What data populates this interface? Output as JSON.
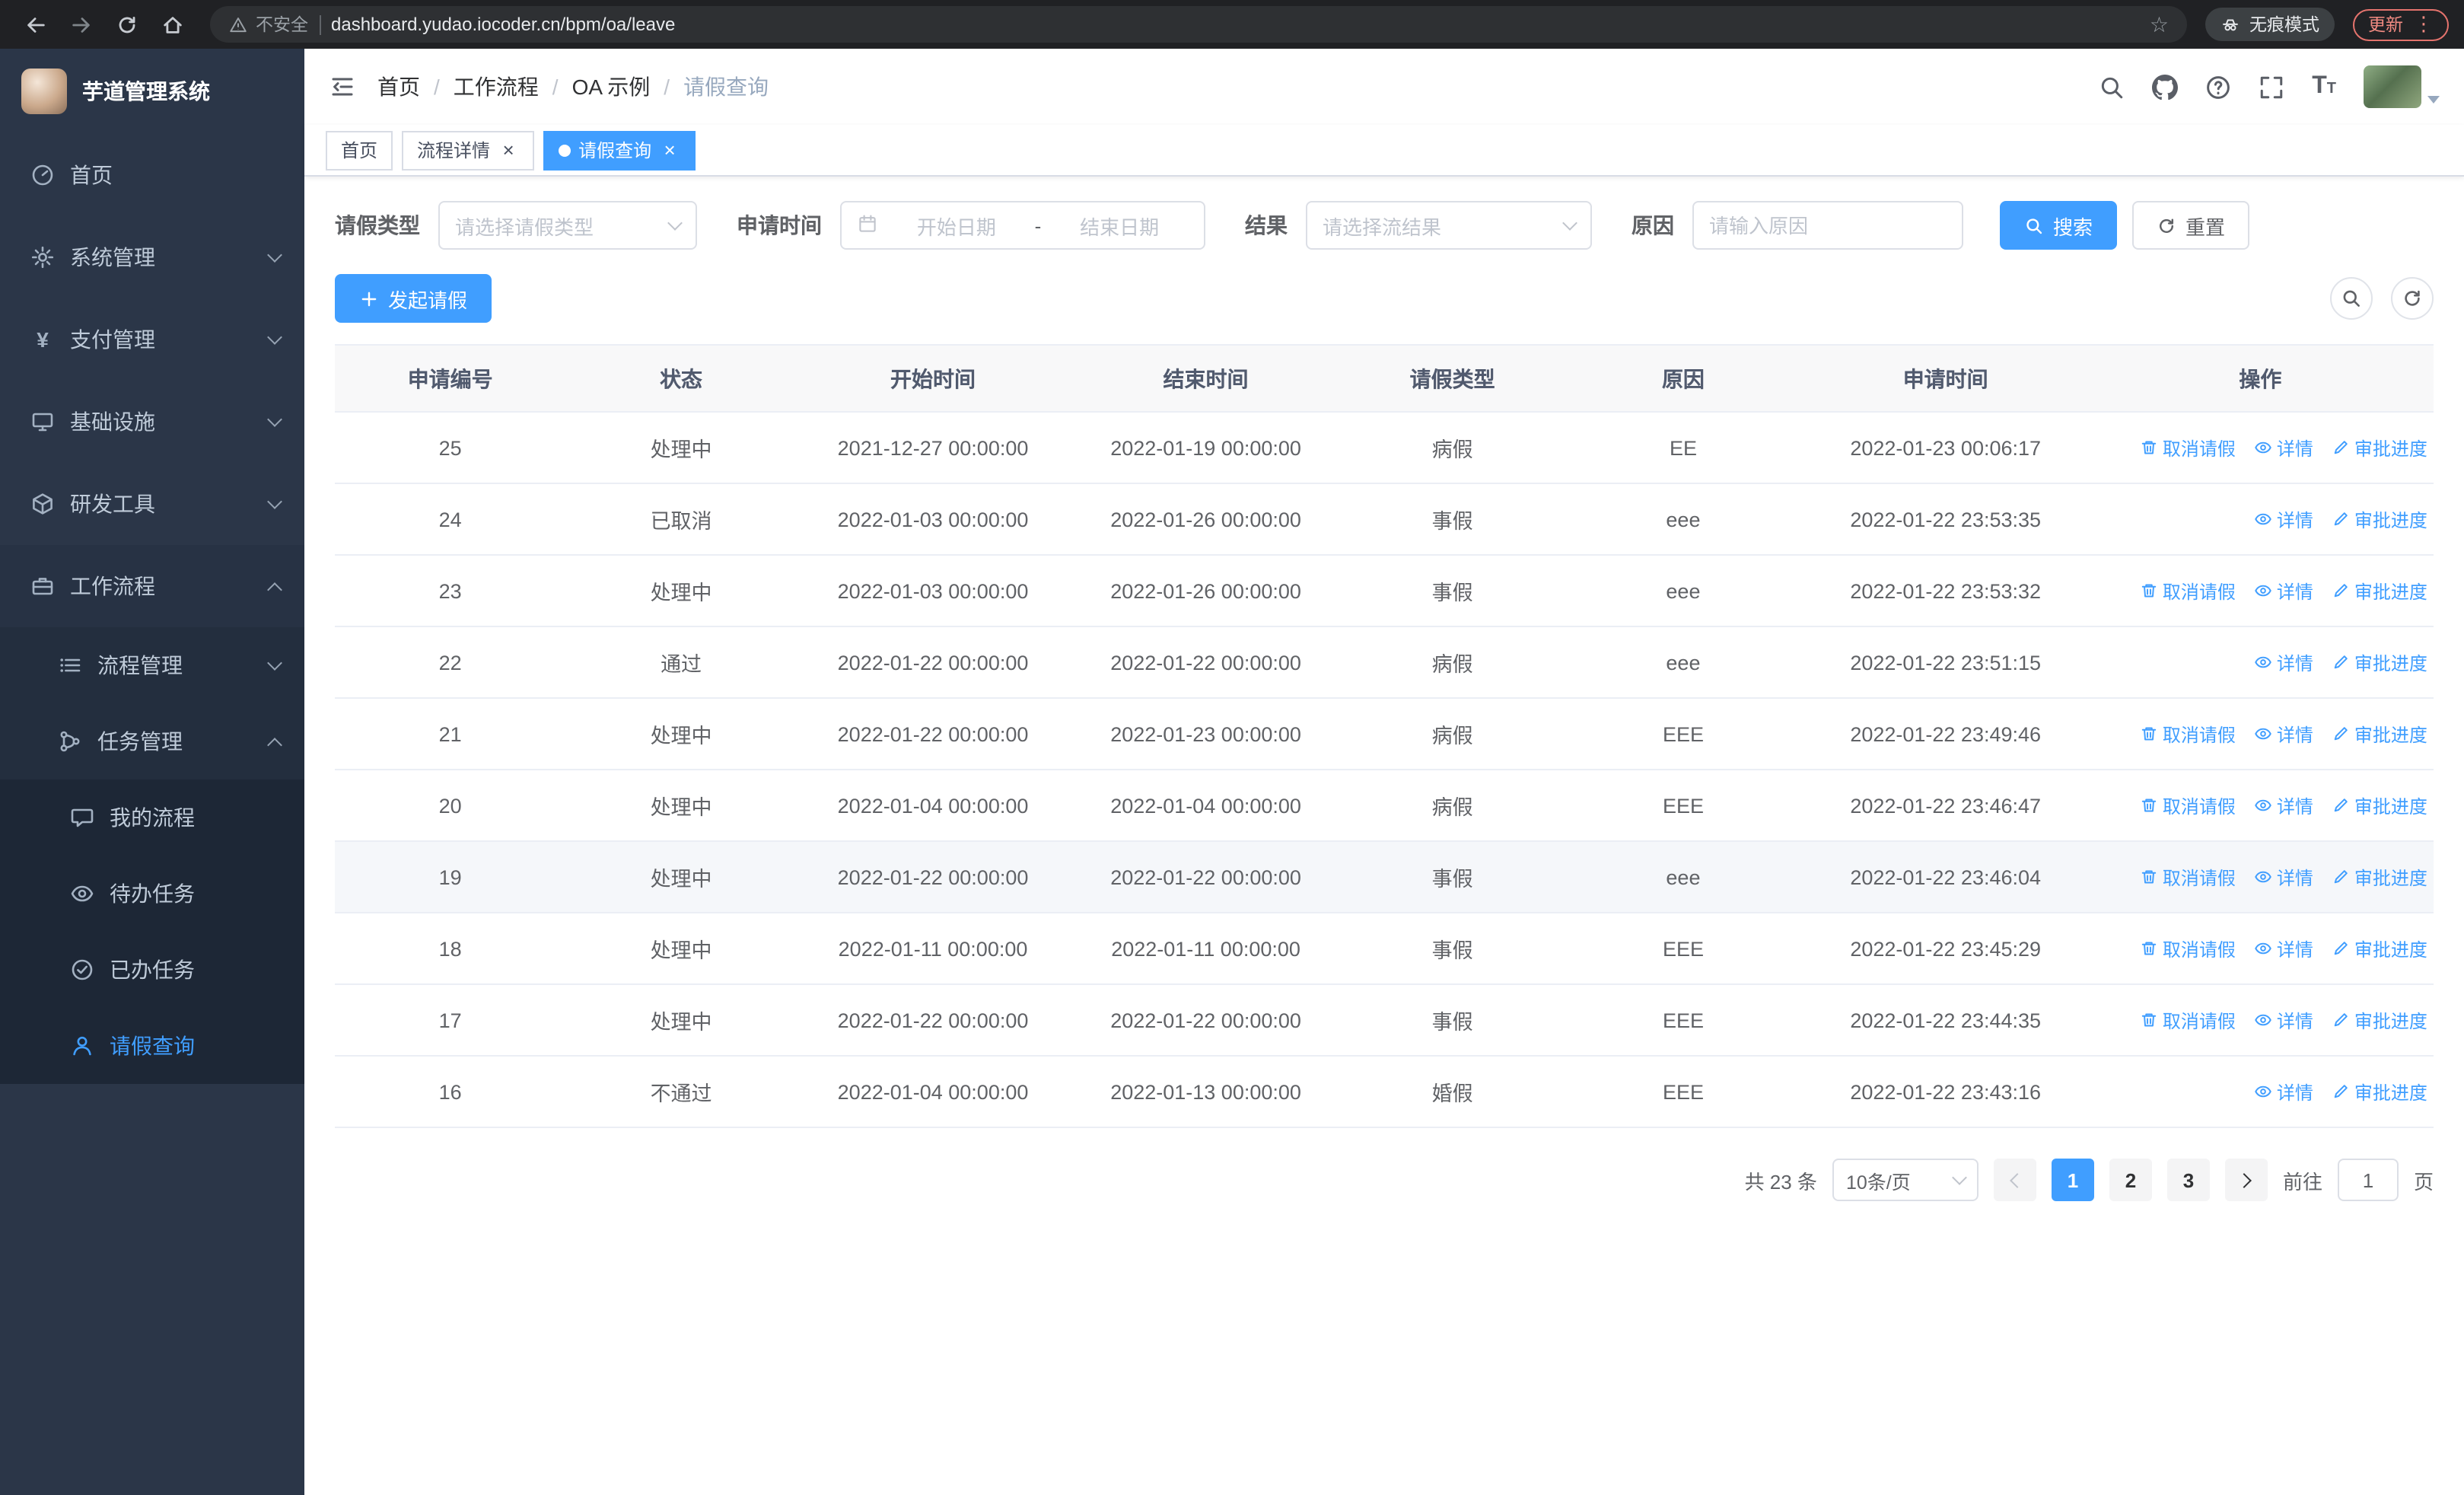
{
  "colors": {
    "primary": "#409eff",
    "sidebar_bg": "#2b3648",
    "update_red": "#f28b82"
  },
  "browser": {
    "security_label": "不安全",
    "url": "dashboard.yudao.iocoder.cn/bpm/oa/leave",
    "incognito_label": "无痕模式",
    "update_label": "更新"
  },
  "sidebar": {
    "title": "芋道管理系统",
    "items": [
      {
        "label": "首页"
      },
      {
        "label": "系统管理"
      },
      {
        "label": "支付管理"
      },
      {
        "label": "基础设施"
      },
      {
        "label": "研发工具"
      },
      {
        "label": "工作流程"
      },
      {
        "label": "流程管理"
      },
      {
        "label": "任务管理"
      },
      {
        "label": "我的流程"
      },
      {
        "label": "待办任务"
      },
      {
        "label": "已办任务"
      },
      {
        "label": "请假查询"
      }
    ]
  },
  "navbar": {
    "breadcrumb": [
      "首页",
      "工作流程",
      "OA 示例",
      "请假查询"
    ]
  },
  "tabs": [
    {
      "label": "首页"
    },
    {
      "label": "流程详情"
    },
    {
      "label": "请假查询"
    }
  ],
  "filters": {
    "leave_type_label": "请假类型",
    "leave_type_placeholder": "请选择请假类型",
    "apply_time_label": "申请时间",
    "start_placeholder": "开始日期",
    "range_separator": "-",
    "end_placeholder": "结束日期",
    "result_label": "结果",
    "result_placeholder": "请选择流结果",
    "reason_label": "原因",
    "reason_placeholder": "请输入原因",
    "search_label": "搜索",
    "reset_label": "重置"
  },
  "toolbar": {
    "create_label": "发起请假"
  },
  "table": {
    "headers": [
      "申请编号",
      "状态",
      "开始时间",
      "结束时间",
      "请假类型",
      "原因",
      "申请时间",
      "操作"
    ],
    "action_labels": {
      "cancel": "取消请假",
      "detail": "详情",
      "progress": "审批进度"
    },
    "rows": [
      {
        "id": "25",
        "status": "处理中",
        "start": "2021-12-27 00:00:00",
        "end": "2022-01-19 00:00:00",
        "type": "病假",
        "reason": "EE",
        "applied": "2022-01-23 00:06:17",
        "actions": [
          "cancel",
          "detail",
          "progress"
        ]
      },
      {
        "id": "24",
        "status": "已取消",
        "start": "2022-01-03 00:00:00",
        "end": "2022-01-26 00:00:00",
        "type": "事假",
        "reason": "eee",
        "applied": "2022-01-22 23:53:35",
        "actions": [
          "detail",
          "progress"
        ]
      },
      {
        "id": "23",
        "status": "处理中",
        "start": "2022-01-03 00:00:00",
        "end": "2022-01-26 00:00:00",
        "type": "事假",
        "reason": "eee",
        "applied": "2022-01-22 23:53:32",
        "actions": [
          "cancel",
          "detail",
          "progress"
        ]
      },
      {
        "id": "22",
        "status": "通过",
        "start": "2022-01-22 00:00:00",
        "end": "2022-01-22 00:00:00",
        "type": "病假",
        "reason": "eee",
        "applied": "2022-01-22 23:51:15",
        "actions": [
          "detail",
          "progress"
        ]
      },
      {
        "id": "21",
        "status": "处理中",
        "start": "2022-01-22 00:00:00",
        "end": "2022-01-23 00:00:00",
        "type": "病假",
        "reason": "EEE",
        "applied": "2022-01-22 23:49:46",
        "actions": [
          "cancel",
          "detail",
          "progress"
        ]
      },
      {
        "id": "20",
        "status": "处理中",
        "start": "2022-01-04 00:00:00",
        "end": "2022-01-04 00:00:00",
        "type": "病假",
        "reason": "EEE",
        "applied": "2022-01-22 23:46:47",
        "actions": [
          "cancel",
          "detail",
          "progress"
        ]
      },
      {
        "id": "19",
        "status": "处理中",
        "start": "2022-01-22 00:00:00",
        "end": "2022-01-22 00:00:00",
        "type": "事假",
        "reason": "eee",
        "applied": "2022-01-22 23:46:04",
        "actions": [
          "cancel",
          "detail",
          "progress"
        ],
        "hover": true
      },
      {
        "id": "18",
        "status": "处理中",
        "start": "2022-01-11 00:00:00",
        "end": "2022-01-11 00:00:00",
        "type": "事假",
        "reason": "EEE",
        "applied": "2022-01-22 23:45:29",
        "actions": [
          "cancel",
          "detail",
          "progress"
        ]
      },
      {
        "id": "17",
        "status": "处理中",
        "start": "2022-01-22 00:00:00",
        "end": "2022-01-22 00:00:00",
        "type": "事假",
        "reason": "EEE",
        "applied": "2022-01-22 23:44:35",
        "actions": [
          "cancel",
          "detail",
          "progress"
        ]
      },
      {
        "id": "16",
        "status": "不通过",
        "start": "2022-01-04 00:00:00",
        "end": "2022-01-13 00:00:00",
        "type": "婚假",
        "reason": "EEE",
        "applied": "2022-01-22 23:43:16",
        "actions": [
          "detail",
          "progress"
        ]
      }
    ]
  },
  "pagination": {
    "total": "共 23 条",
    "page_size": "10条/页",
    "pages": [
      "1",
      "2",
      "3"
    ],
    "active_page": "1",
    "goto_label": "前往",
    "goto_value": "1",
    "goto_unit": "页"
  }
}
